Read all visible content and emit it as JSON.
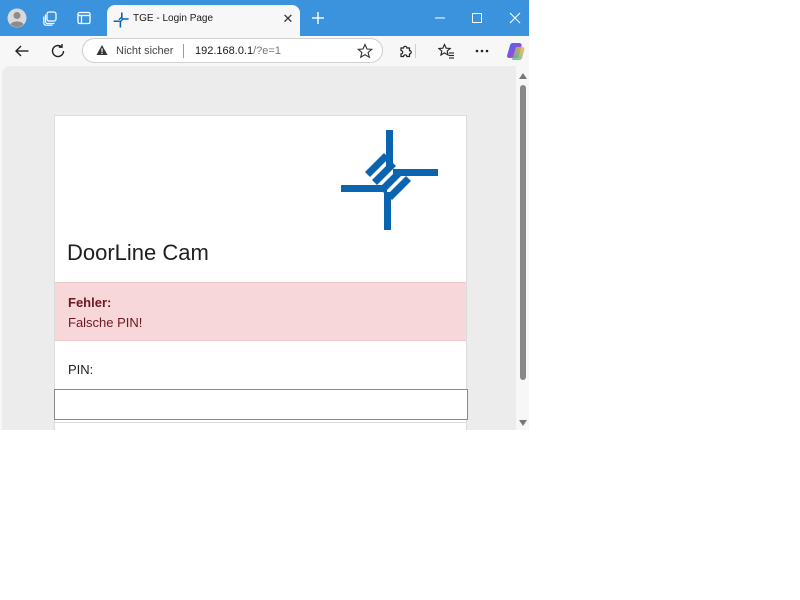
{
  "browser": {
    "tab": {
      "title": "TGE - Login Page",
      "close_label": "✕"
    },
    "addressbar": {
      "security_label": "Nicht sicher",
      "url_host": "192.168.0.1",
      "url_rest": "/?e=1"
    },
    "colors": {
      "tabstrip": "#3b93dd",
      "toolbar": "#f7f7f7"
    },
    "icons": {
      "profile": "profile-avatar-icon",
      "workspaces": "workspaces-icon",
      "tab_actions": "tab-actions-icon",
      "new_tab": "plus-icon",
      "minimize": "minimize-icon",
      "maximize": "maximize-icon",
      "close": "close-icon",
      "back": "back-arrow-icon",
      "refresh": "refresh-icon",
      "warning": "warning-icon",
      "favorite": "star-icon",
      "extensions": "puzzle-icon",
      "favorites": "favorites-list-icon",
      "more": "more-icon",
      "copilot": "copilot-icon"
    }
  },
  "page": {
    "app_title": "DoorLine Cam",
    "alert": {
      "title": "Fehler:",
      "message": "Falsche PIN!"
    },
    "form": {
      "pin_label": "PIN:",
      "pin_value": ""
    },
    "colors": {
      "alert_background": "#f7d7da",
      "alert_text": "#6b1a22",
      "logo_blue": "#0a64b0"
    }
  }
}
